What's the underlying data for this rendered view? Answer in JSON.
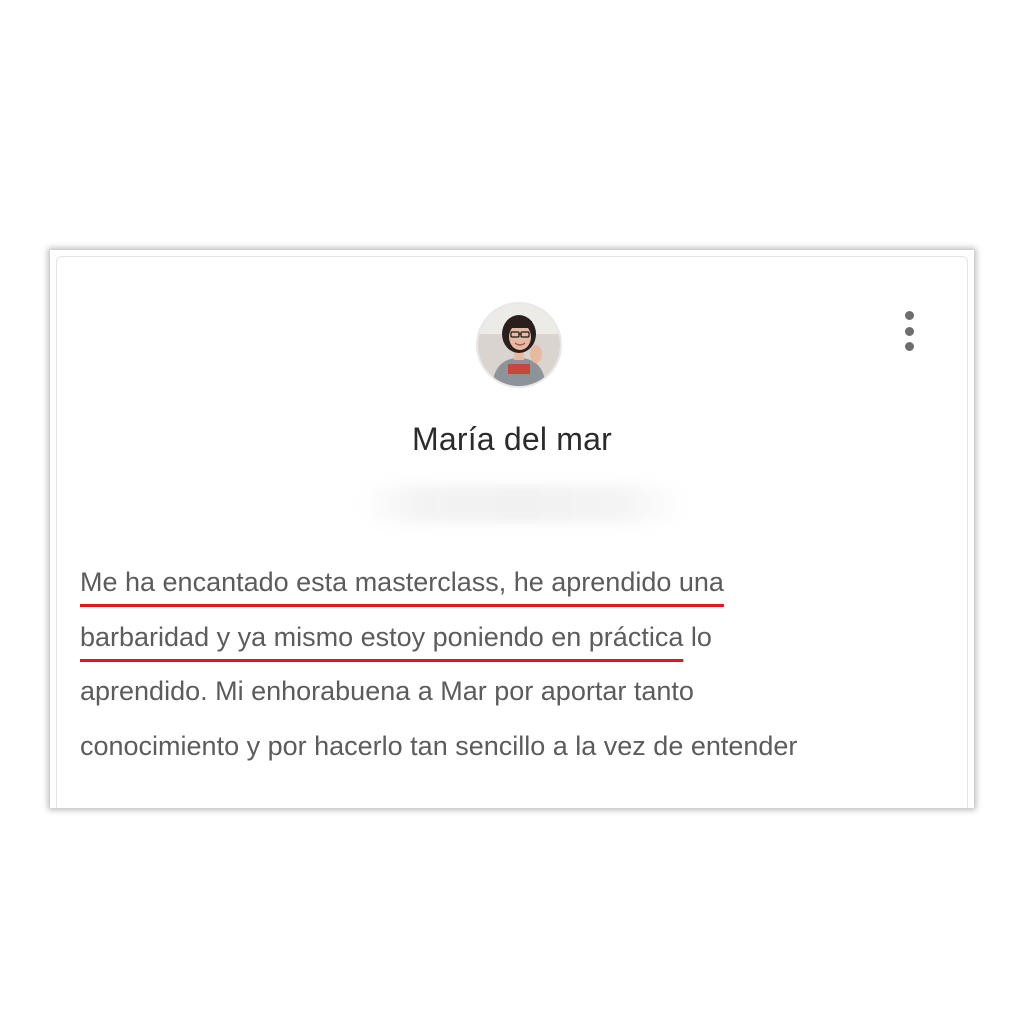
{
  "review": {
    "author_name": "María del mar",
    "avatar": {
      "icon": "profile-photo",
      "colors": {
        "background": "#d9d4cf",
        "hair": "#2a1f1c",
        "skin": "#e7b9a2",
        "shirt": "#8e9399",
        "shirt_print": "#d23a2c"
      }
    },
    "menu_icon": "more-vertical-icon",
    "text_lines": [
      {
        "highlighted": "Me ha encantado esta masterclass, he aprendido una",
        "rest": ""
      },
      {
        "highlighted": "barbaridad y ya mismo estoy poniendo en práctica",
        "rest": " lo"
      },
      {
        "highlighted": "",
        "rest": "aprendido. Mi enhorabuena a Mar por aportar tanto"
      },
      {
        "highlighted": "",
        "rest": "conocimiento y por hacerlo tan sencillo a la vez de entender"
      }
    ],
    "highlight_color": "#e0161e",
    "text_color": "#5c5c5c"
  }
}
